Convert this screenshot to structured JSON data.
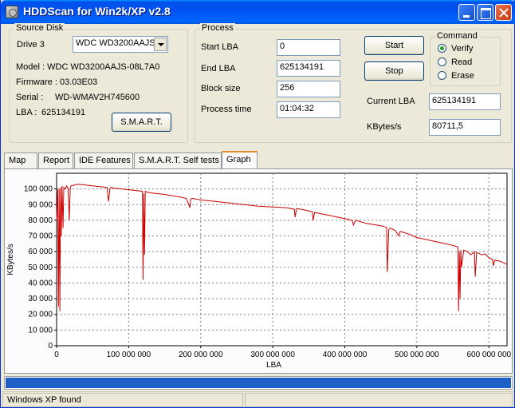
{
  "window": {
    "title": "HDDScan for Win2k/XP  v2.8"
  },
  "source_disk": {
    "legend": "Source Disk",
    "drive_label": "Drive  3",
    "drive_value": "WDC WD3200AAJS",
    "model": "Model : WDC WD3200AAJS-08L7A0",
    "firmware": "Firmware : 03.03E03",
    "serial_label": "Serial :",
    "serial_value": "WD-WMAV2H745600",
    "lba_label": "LBA :",
    "lba_value": "625134191",
    "smart_button": "S.M.A.R.T."
  },
  "process": {
    "legend": "Process",
    "start_lba_label": "Start LBA",
    "start_lba_value": "0",
    "end_lba_label": "End LBA",
    "end_lba_value": "625134191",
    "block_size_label": "Block size",
    "block_size_value": "256",
    "process_time_label": "Process time",
    "process_time_value": "01:04:32",
    "start_button": "Start",
    "stop_button": "Stop",
    "current_lba_label": "Current LBA",
    "current_lba_value": "625134191",
    "kbytes_label": "KBytes/s",
    "kbytes_value": "80711,5"
  },
  "command": {
    "legend": "Command",
    "options": [
      "Verify",
      "Read",
      "Erase"
    ],
    "selected": "Verify"
  },
  "tabs": [
    "Map",
    "Report",
    "IDE Features",
    "S.M.A.R.T. Self tests",
    "Graph"
  ],
  "active_tab": "Graph",
  "progress": {
    "fraction": 1.0,
    "color": "#1e5fc8"
  },
  "status": {
    "text": "Windows XP found"
  },
  "chart_data": {
    "type": "line",
    "xlabel": "LBA",
    "ylabel": "KBytes/s",
    "xlim": [
      0,
      625134191
    ],
    "ylim": [
      0,
      110000
    ],
    "grid": true,
    "line_color": "#cc0000",
    "x_ticks": [
      "0",
      "100 000 000",
      "200 000 000",
      "300 000 000",
      "400 000 000",
      "500 000 000",
      "600 000 000"
    ],
    "x_tick_values": [
      0,
      100000000,
      200000000,
      300000000,
      400000000,
      500000000,
      600000000
    ],
    "y_ticks": [
      "0",
      "10 000",
      "20 000",
      "30 000",
      "40 000",
      "50 000",
      "60 000",
      "70 000",
      "80 000",
      "90 000",
      "100 000"
    ],
    "y_tick_values": [
      0,
      10000,
      20000,
      30000,
      40000,
      50000,
      60000,
      70000,
      80000,
      90000,
      100000
    ],
    "series": [
      {
        "x": [
          0,
          1500000,
          2500000,
          3500000,
          4500000,
          5500000,
          6500000,
          7500000,
          9000000,
          10000000,
          12000000,
          14000000,
          16000000,
          17500000,
          19000000,
          20000000,
          25000000,
          30000000,
          40000000,
          50000000,
          60000000,
          70000000,
          72000000,
          74000000,
          76000000,
          80000000,
          90000000,
          100000000,
          110000000,
          119000000,
          120000000,
          121000000,
          122000000,
          123000000,
          126000000,
          130000000,
          150000000,
          170000000,
          180000000,
          185000000,
          186000000,
          188000000,
          200000000,
          220000000,
          240000000,
          260000000,
          280000000,
          300000000,
          320000000,
          330000000,
          331000000,
          333000000,
          340000000,
          355000000,
          356000000,
          358000000,
          380000000,
          400000000,
          410000000,
          412000000,
          415000000,
          430000000,
          450000000,
          458000000,
          459000000,
          460000000,
          461000000,
          463000000,
          470000000,
          475000000,
          477000000,
          480000000,
          490000000,
          500000000,
          520000000,
          540000000,
          550000000,
          557000000,
          558000000,
          559000000,
          560000000,
          561000000,
          562000000,
          565000000,
          570000000,
          575000000,
          580000000,
          581000000,
          583000000,
          590000000,
          595000000,
          600000000,
          605000000,
          606000000,
          608000000,
          615000000,
          620000000,
          625134191
        ],
        "y": [
          80000,
          100000,
          25000,
          100000,
          22000,
          101000,
          70000,
          102000,
          75000,
          101000,
          100000,
          102000,
          100000,
          80000,
          101000,
          102000,
          102500,
          103000,
          102500,
          102000,
          101500,
          101000,
          92000,
          100000,
          101000,
          100500,
          100000,
          99500,
          99000,
          98500,
          42000,
          97000,
          58000,
          98500,
          98000,
          97500,
          96500,
          95000,
          94000,
          88000,
          93500,
          94000,
          93000,
          92000,
          91000,
          90000,
          89000,
          88500,
          88000,
          87000,
          82000,
          87500,
          87000,
          85500,
          80000,
          85000,
          83000,
          81000,
          80000,
          77000,
          80000,
          78000,
          76500,
          75500,
          47000,
          62000,
          74000,
          75000,
          73500,
          70000,
          73000,
          72500,
          71000,
          69000,
          67000,
          65000,
          64000,
          63000,
          22000,
          60000,
          30000,
          61000,
          50000,
          61000,
          60000,
          58000,
          60000,
          44000,
          59500,
          58000,
          58500,
          56000,
          55000,
          51000,
          54500,
          54000,
          53000,
          52000
        ]
      }
    ]
  }
}
